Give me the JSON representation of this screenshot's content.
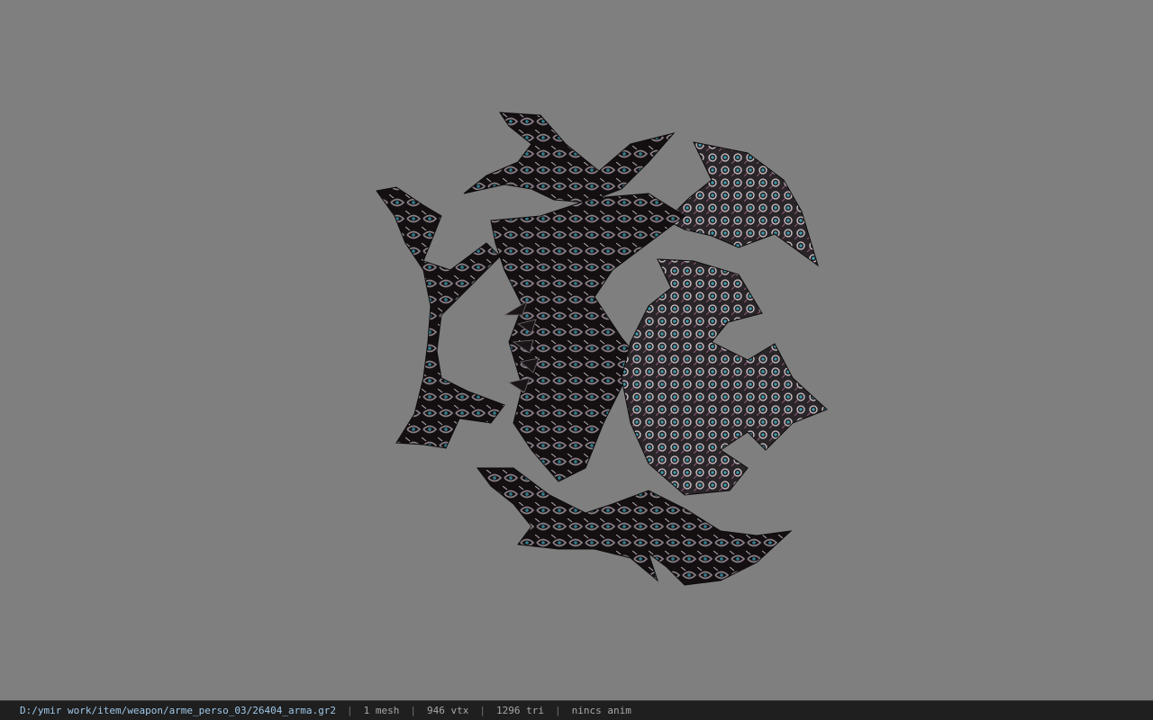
{
  "viewer": {
    "background_color": "#7f7f7f",
    "model": {
      "icon": "ornate-double-bladed-weapon-model",
      "base_color": "#151012",
      "highlight_color": "#c9c2c8",
      "accent_color": "#3a8fa0"
    }
  },
  "status_bar": {
    "file_path": "D:/ymir work/item/weapon/arme_perso_03/26404_arma.gr2",
    "separator": "|",
    "mesh_count": "1 mesh",
    "vertex_count": "946 vtx",
    "triangle_count": "1296 tri",
    "anim_status": "nincs anim"
  }
}
